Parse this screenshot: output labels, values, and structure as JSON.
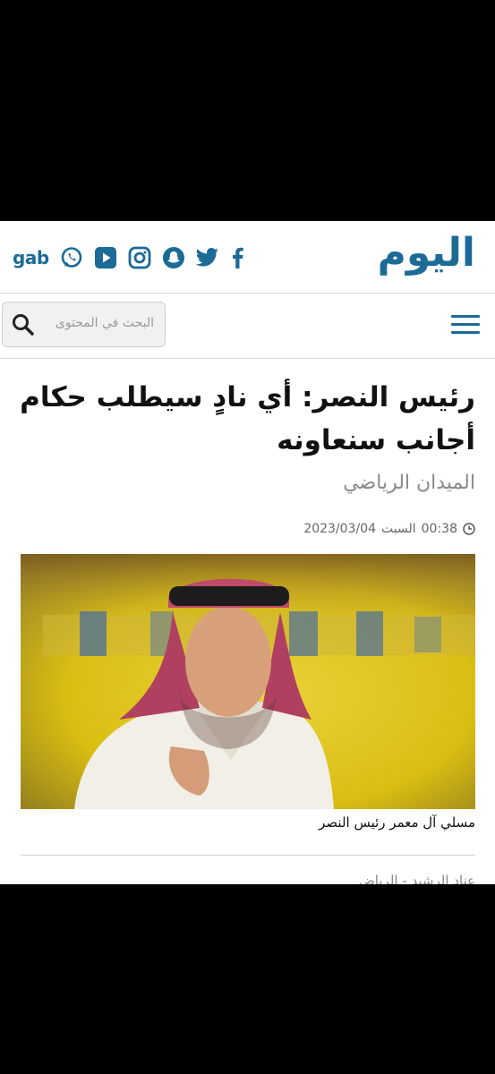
{
  "header": {
    "logo_text": "اليوم",
    "social": [
      "facebook-icon",
      "twitter-icon",
      "snapchat-icon",
      "instagram-icon",
      "youtube-icon",
      "whatsapp-icon"
    ],
    "gab_label": "gab"
  },
  "search": {
    "placeholder": "البحث في المحتوى"
  },
  "article": {
    "title": "رئيس النصر: أي نادٍ سيطلب حكام أجانب سنعاونه",
    "category": "الميدان الرياضي",
    "time": "00:38",
    "day": "السبت",
    "date": "2023/03/04",
    "caption": "مسلي آل معمر رئيس النصر",
    "author": "عناد الرشيد - الرياض"
  },
  "colors": {
    "brand": "#1b6b96",
    "background": "#ffffff"
  }
}
